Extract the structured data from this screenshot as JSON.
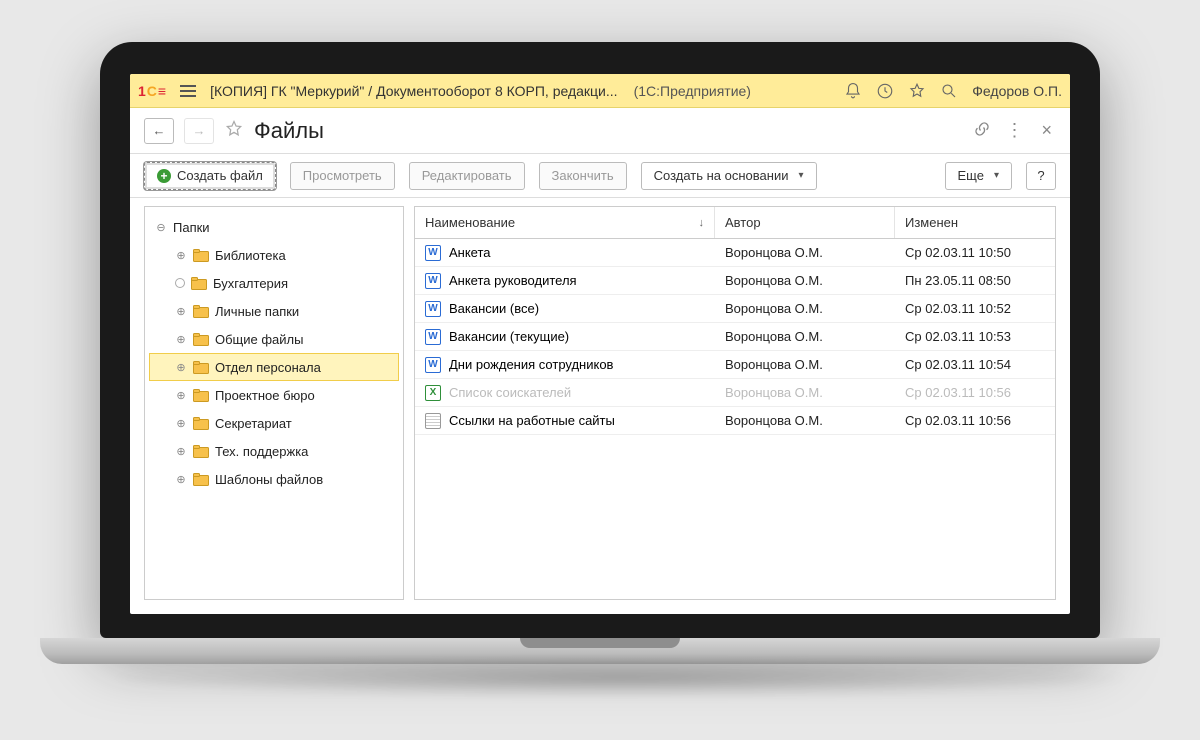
{
  "titlebar": {
    "title": "[КОПИЯ] ГК \"Меркурий\" / Документооборот 8 КОРП, редакци...",
    "app": "(1С:Предприятие)",
    "user": "Федоров О.П."
  },
  "page": {
    "title": "Файлы"
  },
  "toolbar": {
    "create": "Создать файл",
    "view": "Просмотреть",
    "edit": "Редактировать",
    "finish": "Закончить",
    "create_based": "Создать на основании",
    "more": "Еще",
    "help": "?"
  },
  "tree": {
    "root": "Папки",
    "items": [
      {
        "label": "Библиотека",
        "selected": false
      },
      {
        "label": "Бухгалтерия",
        "selected": false,
        "loading": true
      },
      {
        "label": "Личные папки",
        "selected": false
      },
      {
        "label": "Общие файлы",
        "selected": false
      },
      {
        "label": "Отдел персонала",
        "selected": true
      },
      {
        "label": "Проектное бюро",
        "selected": false
      },
      {
        "label": "Секретариат",
        "selected": false
      },
      {
        "label": "Тех. поддержка",
        "selected": false
      },
      {
        "label": "Шаблоны файлов",
        "selected": false
      }
    ]
  },
  "table": {
    "columns": {
      "name": "Наименование",
      "author": "Автор",
      "modified": "Изменен"
    },
    "rows": [
      {
        "icon": "word",
        "name": "Анкета",
        "author": "Воронцова О.М.",
        "modified": "Ср 02.03.11 10:50"
      },
      {
        "icon": "word",
        "name": "Анкета руководителя",
        "author": "Воронцова О.М.",
        "modified": "Пн 23.05.11 08:50"
      },
      {
        "icon": "word",
        "name": "Вакансии (все)",
        "author": "Воронцова О.М.",
        "modified": "Ср 02.03.11 10:52"
      },
      {
        "icon": "word",
        "name": "Вакансии (текущие)",
        "author": "Воронцова О.М.",
        "modified": "Ср 02.03.11 10:53"
      },
      {
        "icon": "word",
        "name": "Дни рождения сотрудников",
        "author": "Воронцова О.М.",
        "modified": "Ср 02.03.11 10:54"
      },
      {
        "icon": "excel",
        "name": "Список соискателей",
        "author": "Воронцова О.М.",
        "modified": "Ср 02.03.11 10:56",
        "dim": true
      },
      {
        "icon": "txt",
        "name": "Ссылки на работные сайты",
        "author": "Воронцова О.М.",
        "modified": "Ср 02.03.11 10:56"
      }
    ]
  }
}
